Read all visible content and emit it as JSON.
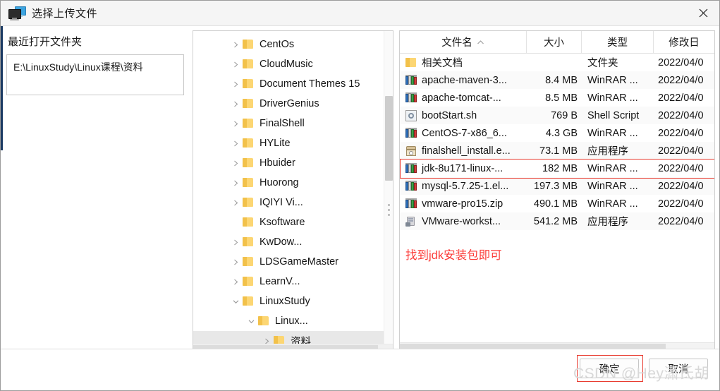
{
  "window": {
    "title": "选择上传文件",
    "icon": "computer-monitor-icon",
    "close_label": "×"
  },
  "left": {
    "recent_label": "最近打开文件夹",
    "path_value": "E:\\LinuxStudy\\Linux课程\\资料"
  },
  "tree": {
    "items": [
      {
        "label": "CentOs",
        "indent": 0,
        "chevron": "right",
        "selected": false
      },
      {
        "label": "CloudMusic",
        "indent": 0,
        "chevron": "right",
        "selected": false
      },
      {
        "label": "Document Themes 15",
        "indent": 0,
        "chevron": "right",
        "selected": false
      },
      {
        "label": "DriverGenius",
        "indent": 0,
        "chevron": "right",
        "selected": false
      },
      {
        "label": "FinalShell",
        "indent": 0,
        "chevron": "right",
        "selected": false
      },
      {
        "label": "HYLite",
        "indent": 0,
        "chevron": "right",
        "selected": false
      },
      {
        "label": "Hbuider",
        "indent": 0,
        "chevron": "right",
        "selected": false
      },
      {
        "label": "Huorong",
        "indent": 0,
        "chevron": "right",
        "selected": false
      },
      {
        "label": "IQIYI Vi...",
        "indent": 0,
        "chevron": "right",
        "selected": false
      },
      {
        "label": "Ksoftware",
        "indent": 0,
        "chevron": "none",
        "selected": false
      },
      {
        "label": "KwDow...",
        "indent": 0,
        "chevron": "right",
        "selected": false
      },
      {
        "label": "LDSGameMaster",
        "indent": 0,
        "chevron": "right",
        "selected": false
      },
      {
        "label": "LearnV...",
        "indent": 0,
        "chevron": "right",
        "selected": false
      },
      {
        "label": "LinuxStudy",
        "indent": 0,
        "chevron": "down",
        "selected": false
      },
      {
        "label": "Linux...",
        "indent": 1,
        "chevron": "down",
        "selected": false
      },
      {
        "label": "资料",
        "indent": 2,
        "chevron": "right",
        "selected": true
      }
    ]
  },
  "filelist": {
    "columns": [
      {
        "key": "name",
        "label": "文件名",
        "sorted": "asc"
      },
      {
        "key": "size",
        "label": "大小",
        "sorted": ""
      },
      {
        "key": "type",
        "label": "类型",
        "sorted": ""
      },
      {
        "key": "date",
        "label": "修改日",
        "sorted": ""
      }
    ],
    "sort_caret": "˄",
    "rows": [
      {
        "name": "相关文档",
        "size": "",
        "type": "文件夹",
        "date": "2022/04/0",
        "icon": "folder-icon",
        "highlight": false
      },
      {
        "name": "apache-maven-3...",
        "size": "8.4 MB",
        "type": "WinRAR ...",
        "date": "2022/04/0",
        "icon": "winrar-icon",
        "highlight": false
      },
      {
        "name": "apache-tomcat-...",
        "size": "8.5 MB",
        "type": "WinRAR ...",
        "date": "2022/04/0",
        "icon": "winrar-icon",
        "highlight": false
      },
      {
        "name": "bootStart.sh",
        "size": "769 B",
        "type": "Shell Script",
        "date": "2022/04/0",
        "icon": "shell-script-icon",
        "highlight": false
      },
      {
        "name": "CentOS-7-x86_6...",
        "size": "4.3 GB",
        "type": "WinRAR ...",
        "date": "2022/04/0",
        "icon": "winrar-icon",
        "highlight": false
      },
      {
        "name": "finalshell_install.e...",
        "size": "73.1 MB",
        "type": "应用程序",
        "date": "2022/04/0",
        "icon": "installer-icon",
        "highlight": false
      },
      {
        "name": "jdk-8u171-linux-...",
        "size": "182 MB",
        "type": "WinRAR ...",
        "date": "2022/04/0",
        "icon": "winrar-icon",
        "highlight": true
      },
      {
        "name": "mysql-5.7.25-1.el...",
        "size": "197.3 MB",
        "type": "WinRAR ...",
        "date": "2022/04/0",
        "icon": "winrar-icon",
        "highlight": false
      },
      {
        "name": "vmware-pro15.zip",
        "size": "490.1 MB",
        "type": "WinRAR ...",
        "date": "2022/04/0",
        "icon": "winrar-icon",
        "highlight": false
      },
      {
        "name": "VMware-workst...",
        "size": "541.2 MB",
        "type": "应用程序",
        "date": "2022/04/0",
        "icon": "vmware-icon",
        "highlight": false
      }
    ]
  },
  "annotations": {
    "note": "找到jdk安装包即可",
    "note_color": "#fc3b38",
    "highlight_color": "#e83b2f"
  },
  "footer": {
    "ok_label": "确定",
    "cancel_label": "取消",
    "watermark": "CSDN @Hey潇氏胡"
  }
}
